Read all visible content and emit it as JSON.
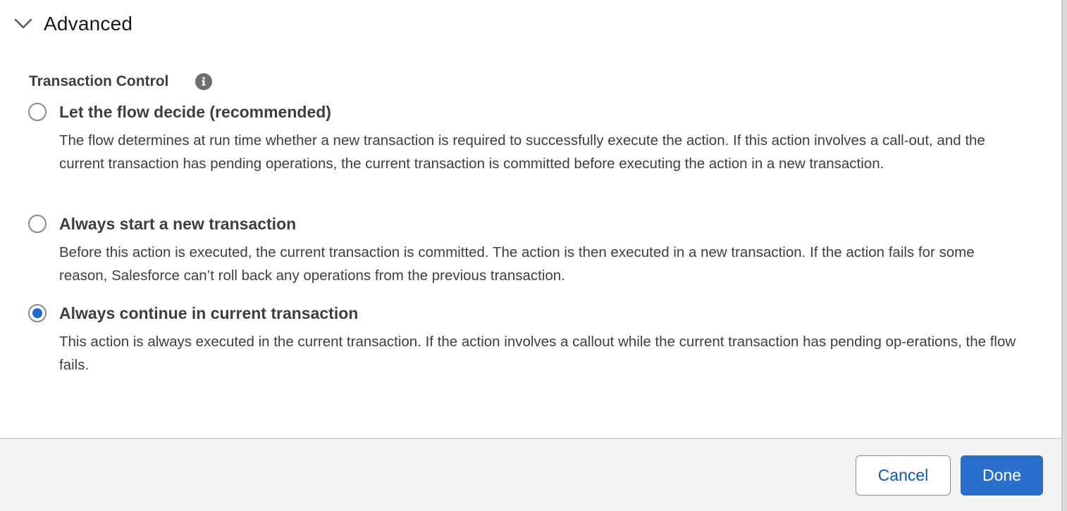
{
  "section": {
    "title": "Advanced",
    "expanded": true,
    "chevron_icon": "chevron-down-icon"
  },
  "transaction_control": {
    "label": "Transaction Control",
    "info_icon": "info-icon",
    "selected": "always_continue",
    "options": [
      {
        "key": "flow_decides",
        "label": "Let the flow decide (recommended)",
        "description": "The flow determines at run time whether a new transaction is required to successfully execute the action. If this action involves a call-out, and the current transaction has pending operations, the current transaction is committed before executing the action in a new transaction.",
        "checked": false
      },
      {
        "key": "always_new",
        "label": "Always start a new transaction",
        "description": "Before this action is executed, the current transaction is committed. The action is then executed in a new transaction. If the action fails for some reason, Salesforce can’t roll back any operations from the previous transaction.",
        "checked": false
      },
      {
        "key": "always_continue",
        "label": "Always continue in current transaction",
        "description": "This action is always executed in the current transaction. If the action involves a callout while the current transaction has pending op-erations, the flow fails.",
        "checked": true
      }
    ]
  },
  "footer": {
    "cancel_label": "Cancel",
    "done_label": "Done"
  },
  "colors": {
    "brand": "#2a6fcb",
    "link": "#0b5cab",
    "text": "#3e3e3c"
  }
}
